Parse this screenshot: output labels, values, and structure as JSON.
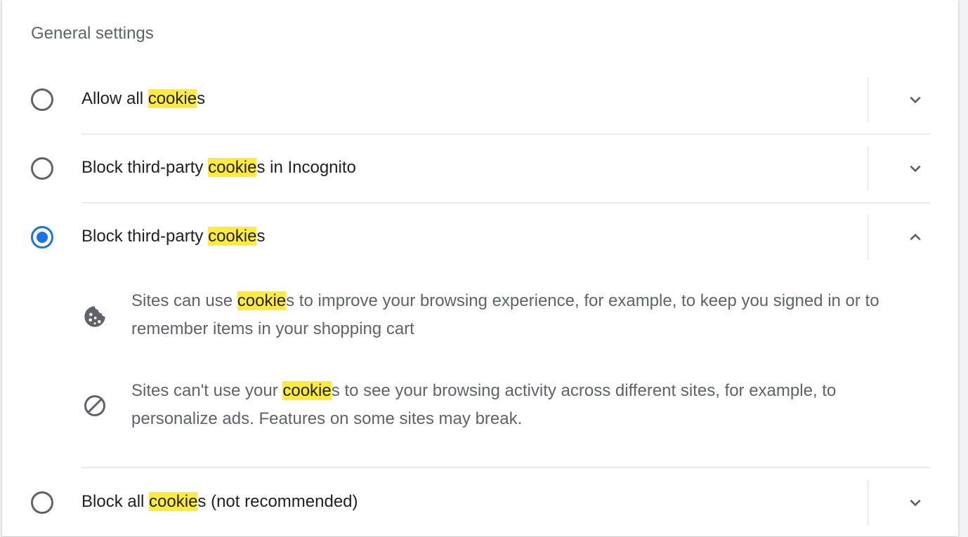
{
  "section": {
    "title": "General settings"
  },
  "options": [
    {
      "pre": "Allow all ",
      "highlight": "cookie",
      "post": "s",
      "selected": false,
      "expanded": false
    },
    {
      "pre": "Block third-party ",
      "highlight": "cookie",
      "post": "s in Incognito",
      "selected": false,
      "expanded": false
    },
    {
      "pre": "Block third-party ",
      "highlight": "cookie",
      "post": "s",
      "selected": true,
      "expanded": true
    },
    {
      "pre": "Block all ",
      "highlight": "cookie",
      "post": "s (not recommended)",
      "selected": false,
      "expanded": false
    }
  ],
  "details": [
    {
      "icon": "cookie-icon",
      "pre": "Sites can use ",
      "highlight": "cookie",
      "post": "s to improve your browsing experience, for example, to keep you signed in or to remember items in your shopping cart"
    },
    {
      "icon": "block-icon",
      "pre": "Sites can't use your ",
      "highlight": "cookie",
      "post": "s to see your browsing activity across different sites, for example, to personalize ads. Features on some sites may break."
    }
  ],
  "colors": {
    "accent": "#1a73e8",
    "highlight": "#ffeb3b",
    "text_primary": "#202124",
    "text_secondary": "#5f6368",
    "divider": "#dadce0"
  }
}
